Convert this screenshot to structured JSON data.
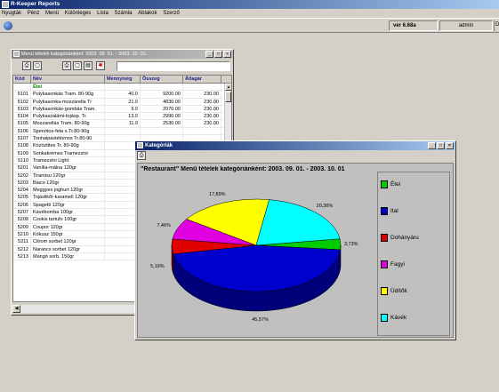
{
  "app": {
    "title": "R-Keeper Reports",
    "menu": [
      "Nyugták",
      "Pénz",
      "Menü",
      "Különleges",
      "Lista",
      "Számla",
      "Ablakok",
      "Szerző"
    ],
    "version": "ver 6.68a",
    "user": "admin"
  },
  "menu_window": {
    "title": "Menü tételek kategóriánként: 2003. 09. 01. - 2003. 10. 01.",
    "columns": [
      "Kód",
      "Név",
      "Mennyiség",
      "Összeg",
      "Átlagár"
    ],
    "group": "Étel",
    "rows": [
      [
        "5101",
        "Pulykasonkás Tram. 80-90g",
        "40.0",
        "9200.00",
        "230.00"
      ],
      [
        "5102",
        "Pulykasonka-mozzarella Tr",
        "21.0",
        "4830.00",
        "230.00"
      ],
      [
        "5103",
        "Pulykasonkás-gombás Tram.",
        "9.0",
        "2070.00",
        "230.00"
      ],
      [
        "5104",
        "Pulykaszalámi-tojásp. Tr.",
        "13.0",
        "2990.00",
        "230.00"
      ],
      [
        "5105",
        "Mozzarellás Tram. 80-90g",
        "11.0",
        "2530.00",
        "230.00"
      ],
      [
        "5106",
        "Spenótos-feta s.Tr.80-90g",
        "",
        "",
        ""
      ],
      [
        "5107",
        "Tonhalpástétomos Tr.80-90",
        "",
        "",
        ""
      ],
      [
        "5108",
        "Közöztites Tr. 80-90g",
        "",
        "",
        ""
      ],
      [
        "5109",
        "Sonkakrémes Tramezzini",
        "",
        "",
        ""
      ],
      [
        "5110",
        "Tramezzini Light",
        "",
        "",
        ""
      ],
      [
        "5201",
        "Vanília-málna 120gr",
        "",
        "",
        ""
      ],
      [
        "5202",
        "Tiramisu 120gr",
        "",
        "",
        ""
      ],
      [
        "5203",
        "Biaco 120gr",
        "",
        "",
        ""
      ],
      [
        "5204",
        "Meggyes joghurt 120gr",
        "",
        "",
        ""
      ],
      [
        "5205",
        "Tojáslikőr-karamell 120gr",
        "",
        "",
        ""
      ],
      [
        "5206",
        "Spagetti 120gr",
        "",
        "",
        ""
      ],
      [
        "5207",
        "Kávébomba 100gr",
        "",
        "",
        ""
      ],
      [
        "5208",
        "Csokis tartufo 100gr",
        "",
        "",
        ""
      ],
      [
        "5209",
        "Coupor 120gr",
        "",
        "",
        ""
      ],
      [
        "5210",
        "Kókusz 150gr",
        "",
        "",
        ""
      ],
      [
        "5211",
        "Citrom sorbet 120gr",
        "",
        "",
        ""
      ],
      [
        "5212",
        "Narancs sorbet 120gr",
        "",
        "",
        ""
      ],
      [
        "5213",
        "Mangó sorb. 150gr",
        "",
        "",
        ""
      ]
    ]
  },
  "category_window": {
    "title": "Kategóriák"
  },
  "chart_data": {
    "type": "pie",
    "title": "\"Restaurant\"  Menü tételek kategóriánként:  2003. 09. 01. - 2003. 10. 01",
    "slices": [
      {
        "name": "Étel",
        "value": 3.73,
        "label": "3,73%",
        "color": "#00cc00"
      },
      {
        "name": "Ital",
        "value": 45.57,
        "label": "45,57%",
        "color": "#0000cc"
      },
      {
        "name": "Dohányáru",
        "value": 5.19,
        "label": "5,19%",
        "color": "#e00000"
      },
      {
        "name": "Fagyi",
        "value": 7.46,
        "label": "7,46%",
        "color": "#e000e0"
      },
      {
        "name": "Üdítők",
        "value": 17.89,
        "label": "17,89%",
        "color": "#ffff00"
      },
      {
        "name": "Kávék",
        "value": 20.36,
        "label": "20,36%",
        "color": "#00ffff"
      }
    ],
    "legend": "right"
  }
}
